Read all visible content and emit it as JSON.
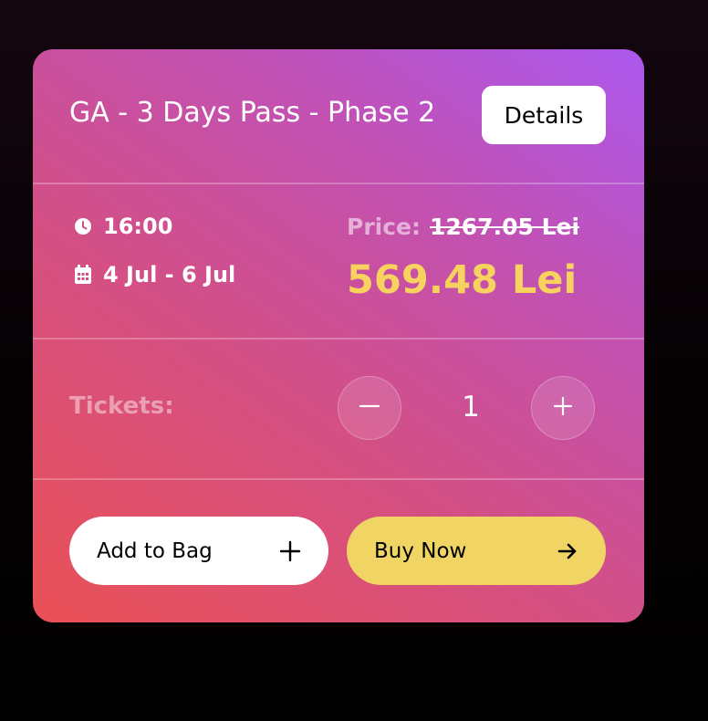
{
  "ticket": {
    "title": "GA - 3 Days Pass - Phase 2",
    "details_label": "Details",
    "time": "16:00",
    "dates": "4 Jul - 6 Jul",
    "price_label": "Price:",
    "old_price": "1267.05 Lei",
    "new_price": "569.48 Lei",
    "tickets_label": "Tickets:",
    "quantity": "1",
    "add_to_bag_label": "Add to Bag",
    "buy_now_label": "Buy Now"
  },
  "icons": {
    "time": "clock-icon",
    "date": "calendar-icon",
    "decrement": "minus-icon",
    "increment": "plus-icon",
    "add_to_bag": "plus-icon",
    "buy_now": "arrow-right-icon"
  },
  "colors": {
    "card_gradient_start": "#ea5155",
    "card_gradient_end": "#ab58ee",
    "new_price": "#f7d25f",
    "buy_button": "#f0d464",
    "add_button": "#ffffff"
  }
}
